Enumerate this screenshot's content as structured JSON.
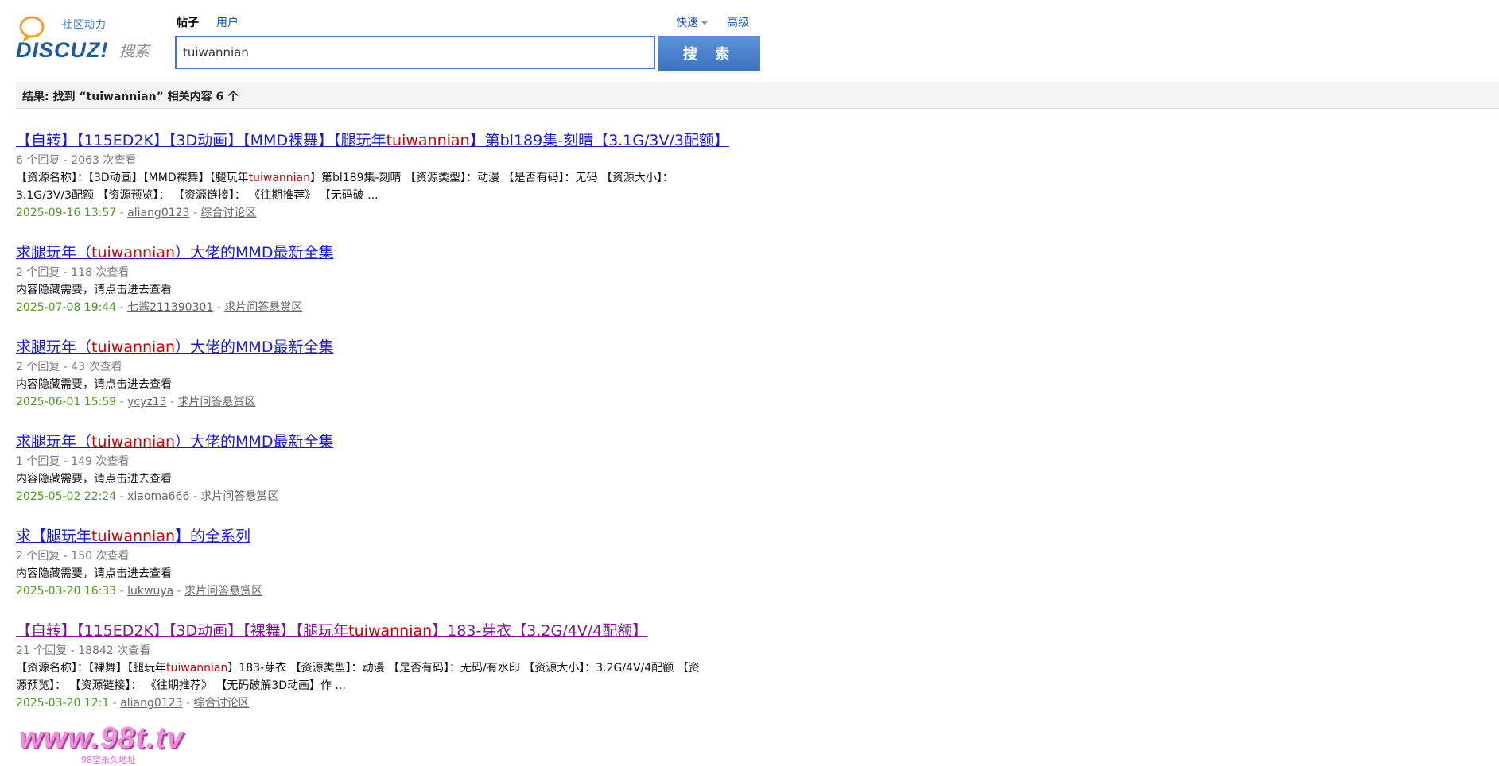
{
  "header": {
    "logo": {
      "subtitle": "社区动力",
      "brand": "DISCUZ!",
      "search_word": "搜索"
    },
    "scope_tabs": [
      {
        "label": "帖子",
        "active": true
      },
      {
        "label": "用户",
        "active": false
      }
    ],
    "quick_links": {
      "quick_label": "快速",
      "advanced_label": "高级"
    },
    "search": {
      "value": "tuiwannian",
      "button_label": "搜 索"
    }
  },
  "summary": {
    "text": "结果: 找到 “tuiwannian” 相关内容 6 个"
  },
  "results": [
    {
      "title_pre": "【自转】【115ED2K】【3D动画】【MMD裸舞】【腿玩年",
      "title_kw": "tuiwannian",
      "title_post": "】第bl189集-刻晴【3.1G/3V/3配额】",
      "meta": "6 个回复 - 2063 次查看",
      "snippet_line1_pre": "【资源名称】：【3D动画】【MMD裸舞】【腿玩年",
      "snippet_line1_kw": "tuiwannian",
      "snippet_line1_post": "】第bl189集-刻晴 【资源类型】：动漫 【是否有码】：无码 【资源大小】：",
      "snippet_line2": "3.1G/3V/3配额 【资源预览】： 【资源链接】： 《往期推荐》 【无码破 ...",
      "date": "2025-09-16 13:57",
      "author": "aliang0123",
      "forum": "综合讨论区",
      "visited": false
    },
    {
      "title_pre": "求腿玩年（",
      "title_kw": "tuiwannian",
      "title_post": "）大佬的MMD最新全集",
      "meta": "2 个回复 - 118 次查看",
      "snippet_line1_pre": "内容隐藏需要，请点击进去查看",
      "snippet_line1_kw": "",
      "snippet_line1_post": "",
      "snippet_line2": "",
      "date": "2025-07-08 19:44",
      "author": "七酱211390301",
      "forum": "求片问答悬赏区",
      "visited": false
    },
    {
      "title_pre": "求腿玩年（",
      "title_kw": "tuiwannian",
      "title_post": "）大佬的MMD最新全集",
      "meta": "2 个回复 - 43 次查看",
      "snippet_line1_pre": "内容隐藏需要，请点击进去查看",
      "snippet_line1_kw": "",
      "snippet_line1_post": "",
      "snippet_line2": "",
      "date": "2025-06-01 15:59",
      "author": "ycyz13",
      "forum": "求片问答悬赏区",
      "visited": false
    },
    {
      "title_pre": "求腿玩年（",
      "title_kw": "tuiwannian",
      "title_post": "）大佬的MMD最新全集",
      "meta": "1 个回复 - 149 次查看",
      "snippet_line1_pre": "内容隐藏需要，请点击进去查看",
      "snippet_line1_kw": "",
      "snippet_line1_post": "",
      "snippet_line2": "",
      "date": "2025-05-02 22:24",
      "author": "xiaoma666",
      "forum": "求片问答悬赏区",
      "visited": false
    },
    {
      "title_pre": "求【腿玩年",
      "title_kw": "tuiwannian",
      "title_post": "】的全系列",
      "meta": "2 个回复 - 150 次查看",
      "snippet_line1_pre": "内容隐藏需要，请点击进去查看",
      "snippet_line1_kw": "",
      "snippet_line1_post": "",
      "snippet_line2": "",
      "date": "2025-03-20 16:33",
      "author": "lukwuya",
      "forum": "求片问答悬赏区",
      "visited": false
    },
    {
      "title_pre": "【自转】【115ED2K】【3D动画】【裸舞】【腿玩年",
      "title_kw": "tuiwannian",
      "title_post": "】183-芽衣【3.2G/4V/4配额】",
      "meta": "21 个回复 - 18842 次查看",
      "snippet_line1_pre": "【资源名称】：【裸舞】【腿玩年",
      "snippet_line1_kw": "tuiwannian",
      "snippet_line1_post": "】183-芽衣 【资源类型】：动漫 【是否有码】：无码/有水印 【资源大小】：3.2G/4V/4配额 【资",
      "snippet_line2": "源预览】： 【资源链接】： 《往期推荐》 【无码破解3D动画】作 ...",
      "date": "2025-03-20 12:1",
      "author": "aliang0123",
      "forum": "综合讨论区",
      "visited": true
    }
  ],
  "watermark": {
    "text": "www.98t.tv",
    "sub": "98堂永久地址"
  }
}
